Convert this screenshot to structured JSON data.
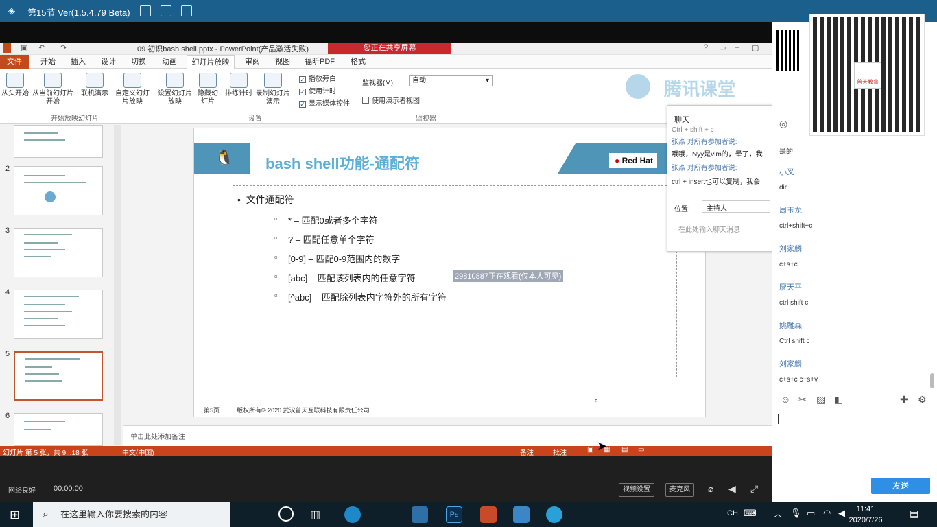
{
  "window": {
    "title": "第15节 Ver(1.5.4.79 Beta)"
  },
  "powerpoint": {
    "doc_title": "09 初识bash shell.pptx - PowerPoint(产品激活失败)",
    "sharing_banner": "您正在共享屏幕",
    "tabs": [
      "文件",
      "开始",
      "插入",
      "设计",
      "切换",
      "动画",
      "幻灯片放映",
      "审阅",
      "视图",
      "福昕PDF",
      "格式"
    ],
    "ribbon_buttons": [
      "从头开始",
      "从当前幻灯片开始",
      "联机演示",
      "自定义幻灯片放映",
      "设置幻灯片放映",
      "隐藏幻灯片",
      "排练计时",
      "录制幻灯片演示"
    ],
    "checkboxes": [
      "播放旁白",
      "使用计时",
      "显示媒体控件"
    ],
    "monitor_label": "监视器(M):",
    "monitor_value": "自动",
    "presenter_view": "使用演示者视图",
    "groups": [
      "开始放映幻灯片",
      "设置",
      "监视器"
    ],
    "thumb_numbers": [
      "2",
      "3",
      "4",
      "5",
      "6"
    ],
    "notes_placeholder": "单击此处添加备注",
    "status_left": "幻灯片 第 5 张，共 9...18 张",
    "status_lang": "中文(中国)",
    "status_notes": "备注",
    "status_comments": "批注"
  },
  "slide": {
    "title": "bash shell功能-通配符",
    "brand": "Red Hat",
    "bullet": "文件通配符",
    "items": [
      "* – 匹配0或者多个字符",
      "? – 匹配任意单个字符",
      "[0-9] – 匹配0-9范围内的数字",
      "[abc] – 匹配该列表内的任意字符",
      "[^abc] – 匹配除列表内字符外的所有字符"
    ],
    "watermark": "29810887正在观看(仅本人可见)",
    "page": "第5页",
    "copyright": "版权所有© 2020 武汉普天互联科技有限责任公司",
    "page_number": "5",
    "logo_text": "腾讯课堂"
  },
  "chat_popup": {
    "title": "聊天",
    "lines": [
      "Ctrl + shift + c",
      "张焱 对所有参加者说:",
      "哦哦，Nyy是vim的，晕了，我",
      "张焱 对所有参加者说:",
      "ctrl + insert也可以复制，我会"
    ],
    "position_label": "位置:",
    "position_value": "主持人",
    "input_placeholder": "在此处输入聊天消息"
  },
  "side_chat": [
    {
      "name": "",
      "msg": "是的"
    },
    {
      "name": "小叉",
      "msg": "dir"
    },
    {
      "name": "周玉龙",
      "msg": "ctrl+shift+c"
    },
    {
      "name": "刘家麟",
      "msg": "c+s+c"
    },
    {
      "name": "廖天平",
      "msg": "ctrl shift c"
    },
    {
      "name": "姚雕森",
      "msg": "Ctrl shift c"
    },
    {
      "name": "刘家麟",
      "msg": "c+s+c   c+s+v"
    }
  ],
  "qr_caption": "普天教育",
  "send_label": "发送",
  "player": {
    "signal": "网络良好",
    "time": "00:00:00",
    "camera_btn": "视频设置",
    "mic_btn": "麦克风"
  },
  "taskbar": {
    "search_placeholder": "在这里输入你要搜索的内容",
    "lang": "CH",
    "time": "11:41",
    "date": "2020/7/26"
  }
}
